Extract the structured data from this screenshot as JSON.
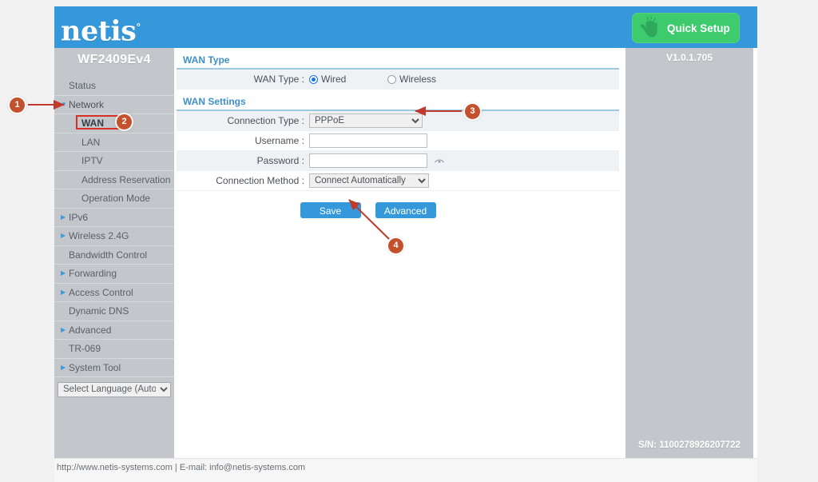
{
  "header": {
    "logo_text": "netis",
    "logo_mark": "°",
    "quick_setup_label": "Quick Setup",
    "quick_setup_icon": "hand-click-icon",
    "accent_blue": "#3498db",
    "accent_green": "#3ecb6e"
  },
  "sidebar": {
    "model_name": "WF2409Ev4",
    "items": [
      {
        "label": "Status",
        "level": 0,
        "expandable": false,
        "highlighted": false
      },
      {
        "label": "Network",
        "level": 0,
        "expandable": true,
        "expanded": true,
        "highlighted": false
      },
      {
        "label": "WAN",
        "level": 1,
        "expandable": false,
        "highlighted": true
      },
      {
        "label": "LAN",
        "level": 1,
        "expandable": false,
        "highlighted": false
      },
      {
        "label": "IPTV",
        "level": 1,
        "expandable": false,
        "highlighted": false
      },
      {
        "label": "Address Reservation",
        "level": 1,
        "expandable": false,
        "highlighted": false
      },
      {
        "label": "Operation Mode",
        "level": 1,
        "expandable": false,
        "highlighted": false
      },
      {
        "label": "IPv6",
        "level": 0,
        "expandable": true,
        "expanded": false,
        "highlighted": false
      },
      {
        "label": "Wireless 2.4G",
        "level": 0,
        "expandable": true,
        "expanded": false,
        "highlighted": false
      },
      {
        "label": "Bandwidth Control",
        "level": 0,
        "expandable": false,
        "highlighted": false
      },
      {
        "label": "Forwarding",
        "level": 0,
        "expandable": true,
        "expanded": false,
        "highlighted": false
      },
      {
        "label": "Access Control",
        "level": 0,
        "expandable": true,
        "expanded": false,
        "highlighted": false
      },
      {
        "label": "Dynamic DNS",
        "level": 0,
        "expandable": false,
        "highlighted": false
      },
      {
        "label": "Advanced",
        "level": 0,
        "expandable": true,
        "expanded": false,
        "highlighted": false
      },
      {
        "label": "TR-069",
        "level": 0,
        "expandable": false,
        "highlighted": false
      },
      {
        "label": "System Tool",
        "level": 0,
        "expandable": true,
        "expanded": false,
        "highlighted": false
      }
    ],
    "language_selected": "Select Language (Auto)",
    "language_options": [
      "Select Language (Auto)"
    ]
  },
  "content": {
    "wan_type_section_title": "WAN Type",
    "wan_type_label": "WAN Type :",
    "wan_type_options": [
      {
        "label": "Wired",
        "checked": true
      },
      {
        "label": "Wireless",
        "checked": false
      }
    ],
    "wan_settings_section_title": "WAN Settings",
    "connection_type_label": "Connection Type :",
    "connection_type_value": "PPPoE",
    "connection_type_options": [
      "PPPoE"
    ],
    "username_label": "Username :",
    "username_value": "",
    "username_placeholder": "",
    "password_label": "Password :",
    "password_value": "",
    "password_placeholder": "",
    "password_reveal_icon": "eye-icon",
    "connection_method_label": "Connection Method :",
    "connection_method_value": "Connect Automatically",
    "connection_method_options": [
      "Connect Automatically"
    ],
    "save_label": "Save",
    "advanced_label": "Advanced"
  },
  "right_panel": {
    "firmware_version": "V1.0.1.705",
    "serial_number": "S/N: 1100278926207722"
  },
  "footer": {
    "text": "http://www.netis-systems.com | E-mail: info@netis-systems.com"
  },
  "annotations": {
    "marker_color": "#c4512d",
    "arrow_color": "#c0392b",
    "highlight_box_color": "#d93025",
    "markers": [
      {
        "number": "1",
        "target": "sidebar-item-network"
      },
      {
        "number": "2",
        "target": "sidebar-item-wan"
      },
      {
        "number": "3",
        "target": "connection-type-select"
      },
      {
        "number": "4",
        "target": "save-button"
      }
    ]
  }
}
